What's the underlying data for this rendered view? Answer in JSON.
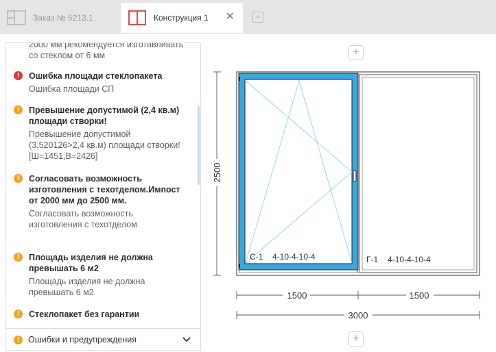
{
  "tabs": {
    "order_label": "Заказ № 5213.1",
    "construction_label": "Конструкция 1",
    "close_symbol": "✕",
    "add_symbol": "+"
  },
  "messages": {
    "top_cut_text": "2000 мм рекомендуется изготавливать со стеклом от 6 мм",
    "items": [
      {
        "type": "error",
        "icon": "error-icon",
        "title": "Ошибка площади стеклопакета",
        "body": "Ошибка площади СП"
      },
      {
        "type": "warning",
        "icon": "warning-icon",
        "title": "Превышение допустимой (2,4 кв.м) площади створки!",
        "body": "Превышение допустимой (3,520126>2,4 кв.м) площади створки! [Ш=1451,В=2426]"
      },
      {
        "type": "warning",
        "icon": "warning-icon",
        "title": "Согласовать возможность изготовления с техотделом.Импост от 2000 мм до 2500 мм.",
        "body": "Согласовать возможность изготовления с техотделом"
      },
      {
        "type": "warning",
        "icon": "warning-icon",
        "title": "Площадь изделия не должна превышать 6 м2",
        "body": "Площадь изделия не должна превышать 6 м2"
      },
      {
        "type": "warning",
        "icon": "warning-icon",
        "title": "Стеклопакет без гарантии",
        "body": ""
      }
    ],
    "footer_label": "Ошибки и предупреждения",
    "footer_chevron": "⌄"
  },
  "drawing": {
    "height_dim": "2500",
    "left_width_dim": "1500",
    "right_width_dim": "1500",
    "total_width_dim": "3000",
    "sash_label": "С-1",
    "sash_glass": "4-10-4-10-4",
    "fixed_label": "Г-1",
    "fixed_glass": "4-10-4-10-4",
    "add_symbol": "+"
  },
  "colors": {
    "selected_frame": "#3aa8e0",
    "error": "#d9363e",
    "warning": "#f1a511",
    "dim_line": "#555555"
  }
}
